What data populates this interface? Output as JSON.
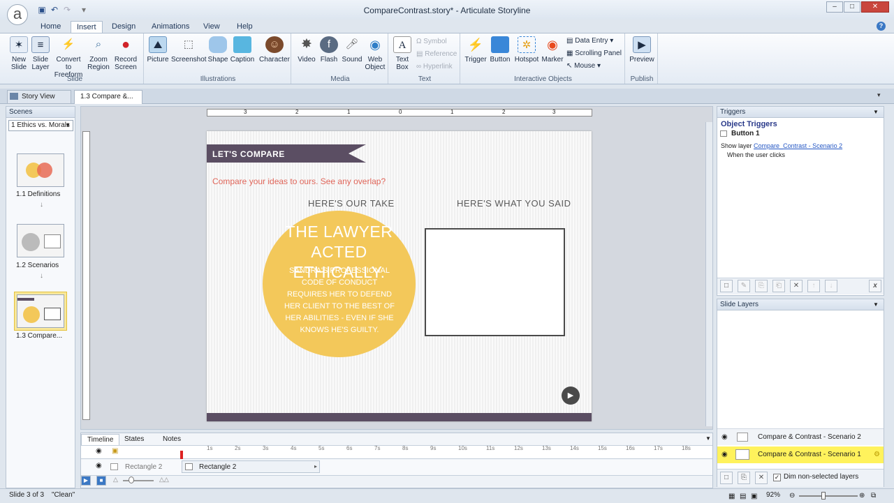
{
  "window": {
    "title": "CompareContrast.story* - Articulate Storyline"
  },
  "ribbon_tabs": [
    "Home",
    "Insert",
    "Design",
    "Animations",
    "View",
    "Help"
  ],
  "ribbon": {
    "slide_group": {
      "label": "Slide",
      "new_slide": "New Slide",
      "slide_layer": "Slide Layer",
      "convert": "Convert to Freeform",
      "zoom": "Zoom Region",
      "record": "Record Screen"
    },
    "illustrations_group": {
      "label": "Illustrations",
      "picture": "Picture",
      "screenshot": "Screenshot",
      "shape": "Shape",
      "caption": "Caption",
      "character": "Character"
    },
    "media_group": {
      "label": "Media",
      "video": "Video",
      "flash": "Flash",
      "sound": "Sound",
      "web_object": "Web Object"
    },
    "text_group": {
      "label": "Text",
      "text_box": "Text Box",
      "symbol": "Symbol",
      "reference": "Reference",
      "hyperlink": "Hyperlink"
    },
    "interactive_group": {
      "label": "Interactive Objects",
      "trigger": "Trigger",
      "button": "Button",
      "hotspot": "Hotspot",
      "marker": "Marker",
      "data_entry": "Data Entry",
      "scrolling_panel": "Scrolling Panel",
      "mouse": "Mouse"
    },
    "publish_group": {
      "label": "Publish",
      "preview": "Preview"
    }
  },
  "doc_tabs": {
    "story_view": "Story View",
    "current": "1.3 Compare &..."
  },
  "scenes": {
    "header": "Scenes",
    "selected_scene": "1 Ethics vs. Morals",
    "slides": [
      {
        "label": "1.1 Definitions"
      },
      {
        "label": "1.2 Scenarios"
      },
      {
        "label": "1.3 Compare..."
      }
    ]
  },
  "slide": {
    "banner": "LET'S COMPARE",
    "subtitle": "Compare your ideas to ours. See any overlap?",
    "left_heading": "HERE'S OUR TAKE",
    "right_heading": "HERE'S WHAT YOU SAID",
    "circle_title": "THE LAWYER ACTED ETHICALLY.",
    "circle_body": "SANDRA'S PROFESSIONAL CODE OF CONDUCT REQUIRES HER TO DEFEND HER CLIENT TO THE BEST OF HER ABILITIES - EVEN IF SHE KNOWS HE'S GUILTY."
  },
  "ruler": {
    "labels": [
      "3",
      "2",
      "1",
      "0",
      "1",
      "2",
      "3"
    ]
  },
  "triggers": {
    "header": "Triggers",
    "section": "Object Triggers",
    "object": "Button 1",
    "action_prefix": "Show layer",
    "action_link": "Compare_Contrast - Scenario 2",
    "condition": "When the user clicks"
  },
  "layers": {
    "header": "Slide Layers",
    "items": [
      {
        "label": "Compare & Contrast - Scenario 2"
      },
      {
        "label": "Compare & Contrast - Scenario 1"
      }
    ],
    "dim_label": "Dim non-selected layers"
  },
  "timeline": {
    "tabs": [
      "Timeline",
      "States",
      "Notes"
    ],
    "row_label": "Rectangle 2",
    "bar_label": "Rectangle 2",
    "ticks": [
      "1s",
      "2s",
      "3s",
      "4s",
      "5s",
      "6s",
      "7s",
      "8s",
      "9s",
      "10s",
      "11s",
      "12s",
      "13s",
      "14s",
      "15s",
      "16s",
      "17s",
      "18s"
    ]
  },
  "status": {
    "slide": "Slide 3 of 3",
    "theme": "\"Clean\"",
    "zoom": "92%"
  },
  "colors": {
    "banner": "#5b4e63",
    "circle": "#f3c85a",
    "accent_text": "#e0665a",
    "selected_layer": "#fff25c"
  }
}
